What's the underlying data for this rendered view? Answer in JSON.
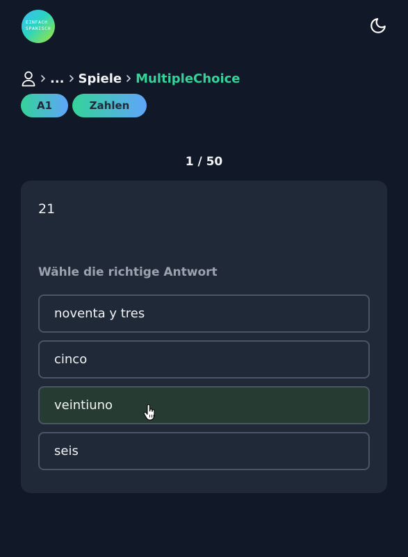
{
  "header": {
    "logo_text": "EINFACH\nSPANISCH",
    "theme_toggle_icon": "moon-icon"
  },
  "breadcrumb": {
    "user_icon": "user-icon",
    "separator_icon": "chevron-right-icon",
    "ellipsis": "...",
    "parent": "Spiele",
    "current": "MultipleChoice"
  },
  "tags": {
    "level": "A1",
    "topic": "Zahlen"
  },
  "quiz": {
    "progress": "1 / 50",
    "question": "21",
    "instruction": "Wähle die richtige Antwort",
    "options": [
      {
        "label": "noventa y tres"
      },
      {
        "label": "cinco"
      },
      {
        "label": "veintiuno"
      },
      {
        "label": "seis"
      }
    ]
  },
  "colors": {
    "background": "#111827",
    "card": "#1f2937",
    "accent": "#34d399",
    "tag_gradient_start": "#34d399",
    "tag_gradient_end": "#60a5fa",
    "option_border": "#4b5563",
    "option_hover": "#263c33"
  }
}
